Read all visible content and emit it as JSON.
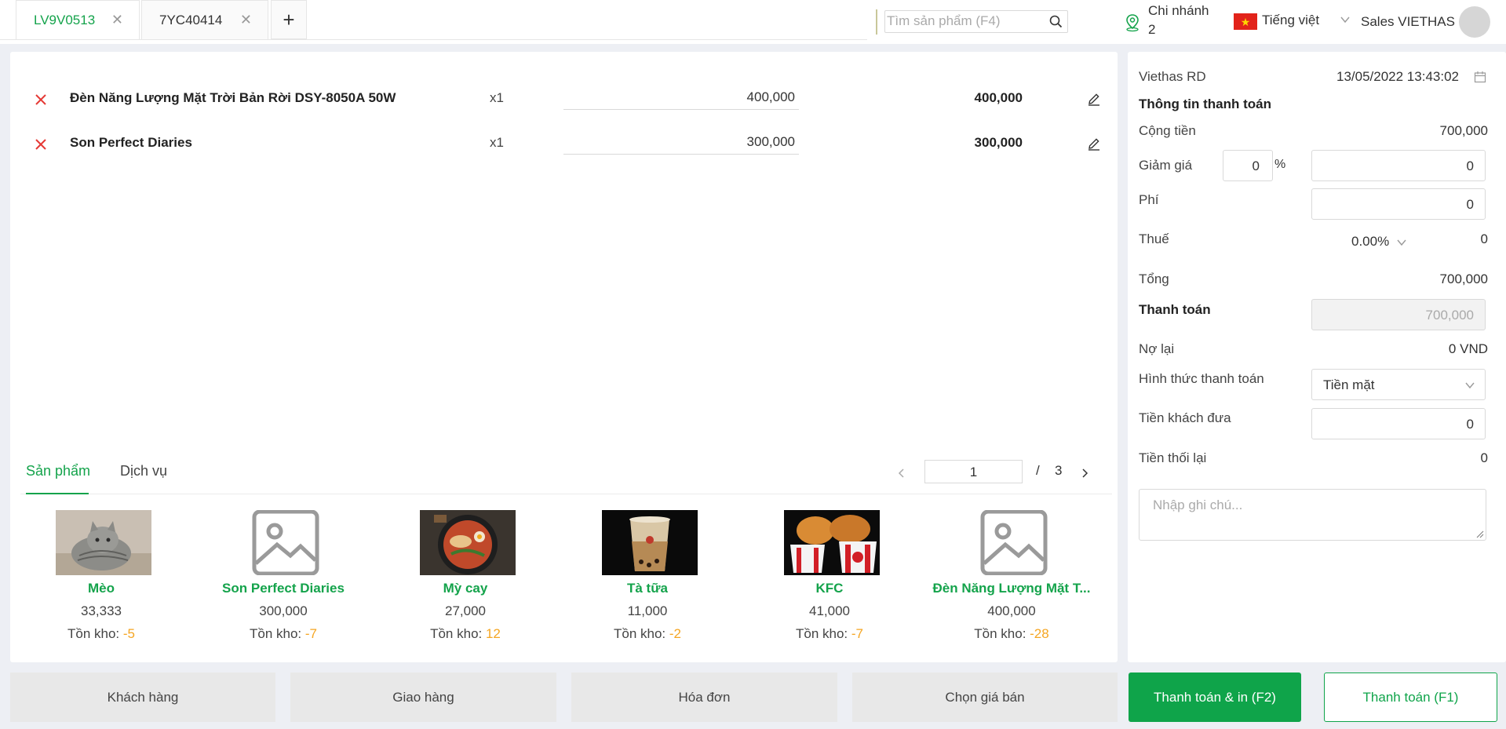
{
  "tabs": [
    {
      "label": "LV9V0513",
      "active": true
    },
    {
      "label": "7YC40414",
      "active": false
    }
  ],
  "tab_add_label": "+",
  "search": {
    "placeholder": "Tìm sản phẩm (F4)"
  },
  "branch": {
    "line1": "Chi nhánh",
    "line2": "2"
  },
  "language": "Tiếng việt",
  "user": "Sales VIETHAS",
  "cart": [
    {
      "name": "Đèn Năng Lượng Mặt Trời Bản Rời DSY-8050A 50W",
      "qty": "x1",
      "price": "400,000",
      "total": "400,000"
    },
    {
      "name": "Son Perfect Diaries",
      "qty": "x1",
      "price": "300,000",
      "total": "300,000"
    }
  ],
  "product_tabs": {
    "products": "Sản phẩm",
    "services": "Dịch vụ"
  },
  "pagination": {
    "current": "1",
    "separator": "/",
    "total": "3"
  },
  "products": [
    {
      "name": "Mèo",
      "price": "33,333",
      "stock_label": "Tồn kho: ",
      "stock": "-5",
      "image": "cat-photo"
    },
    {
      "name": "Son Perfect Diaries",
      "price": "300,000",
      "stock_label": "Tồn kho: ",
      "stock": "-7",
      "image": "image-placeholder-icon"
    },
    {
      "name": "Mỳ cay",
      "price": "27,000",
      "stock_label": "Tồn kho: ",
      "stock": "12",
      "image": "noodle-photo"
    },
    {
      "name": "Tà tữa",
      "price": "11,000",
      "stock_label": "Tồn kho: ",
      "stock": "-2",
      "image": "milk-tea-photo"
    },
    {
      "name": "KFC",
      "price": "41,000",
      "stock_label": "Tồn kho: ",
      "stock": "-7",
      "image": "kfc-photo"
    },
    {
      "name": "Đèn Năng Lượng Mặt T...",
      "price": "400,000",
      "stock_label": "Tồn kho: ",
      "stock": "-28",
      "image": "image-placeholder-icon"
    }
  ],
  "payment": {
    "store": "Viethas RD",
    "datetime": "13/05/2022 13:43:02",
    "section_title": "Thông tin thanh toán",
    "subtotal_label": "Cộng tiền",
    "subtotal": "700,000",
    "discount_label": "Giảm giá",
    "discount_percent": "0",
    "percent_sign": "%",
    "discount_amount": "0",
    "fee_label": "Phí",
    "fee": "0",
    "tax_label": "Thuế",
    "tax_rate": "0.00%",
    "tax": "0",
    "total_label": "Tổng",
    "total": "700,000",
    "pay_label": "Thanh toán",
    "pay_amount": "700,000",
    "debt_label": "Nợ lại",
    "debt": "0 VND",
    "method_label": "Hình thức thanh toán",
    "method": "Tiền mặt",
    "given_label": "Tiền khách đưa",
    "given": "0",
    "change_label": "Tiền thối lại",
    "change": "0",
    "note_placeholder": "Nhập ghi chú..."
  },
  "buttons": {
    "customer": "Khách hàng",
    "delivery": "Giao hàng",
    "invoice": "Hóa đơn",
    "price_select": "Chọn giá bán",
    "pay_print": "Thanh toán & in (F2)",
    "pay": "Thanh toán (F1)"
  },
  "colors": {
    "accent": "#14a34b",
    "stock": "#f5a623",
    "delete": "#e53935"
  }
}
